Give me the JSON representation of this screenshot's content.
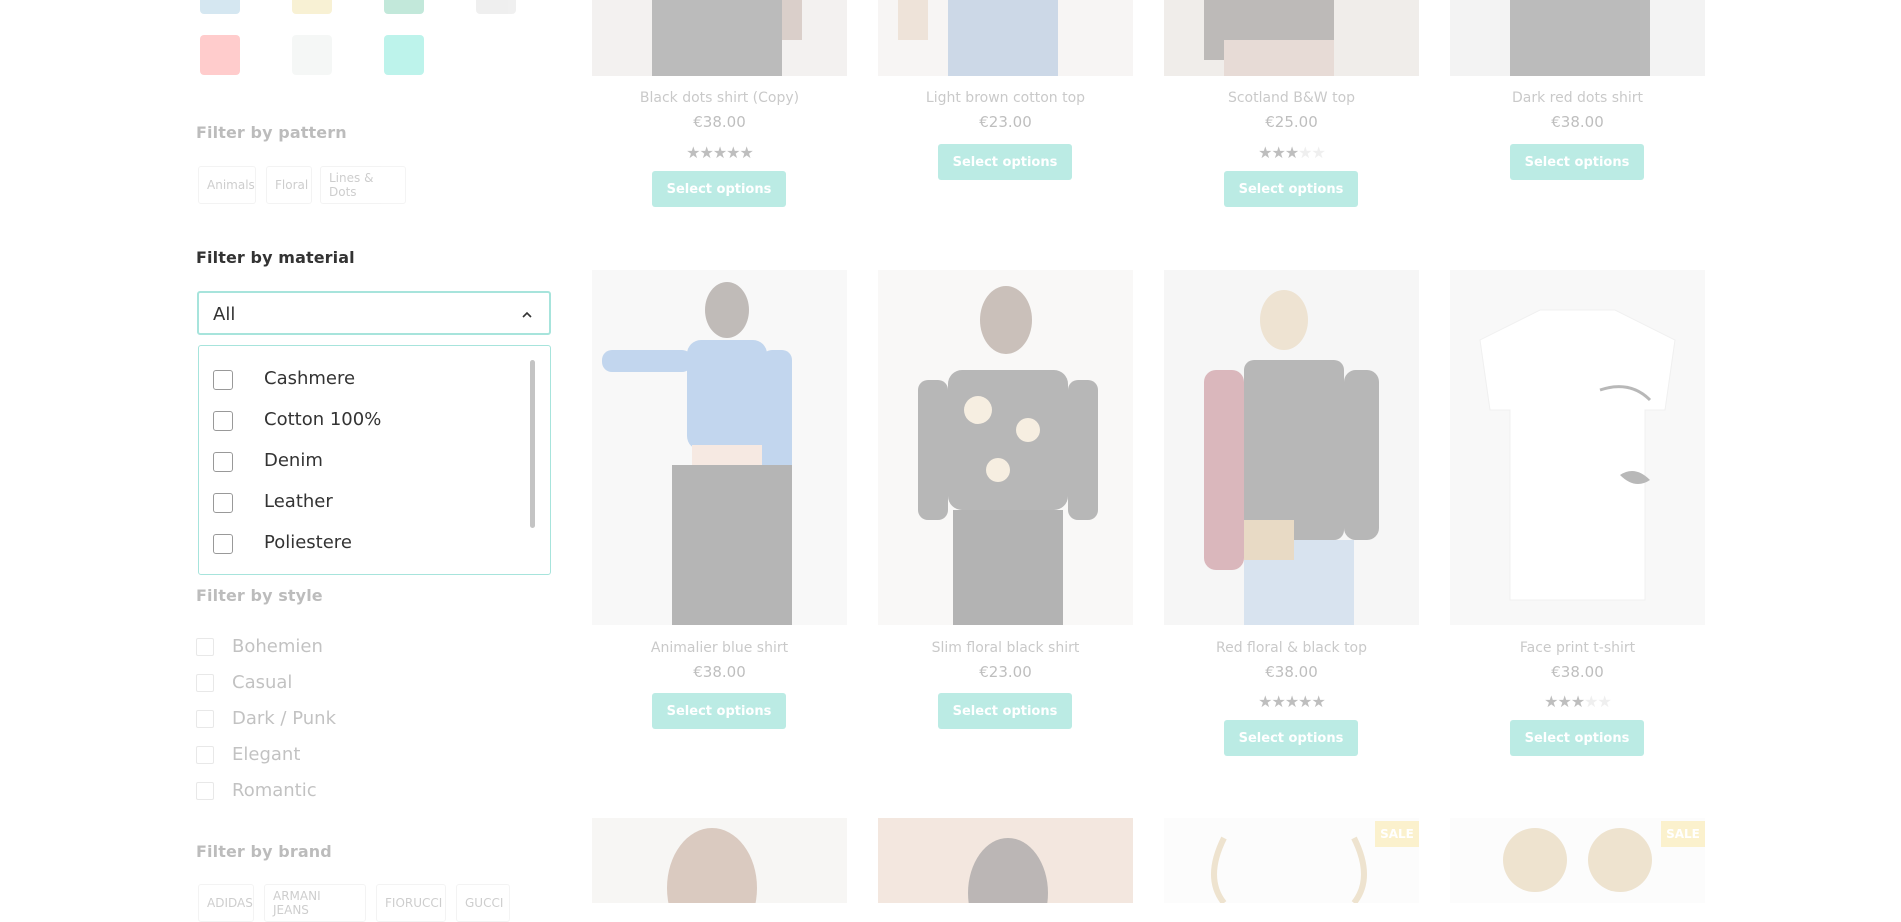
{
  "sidebar": {
    "colors": {
      "top_row": [
        "#7fb6d6",
        "#ecd57b",
        "#43bb8f",
        "#cfcfcf"
      ],
      "second_row": [
        "#ff6464",
        "#e3e8e6",
        "#34dcc4"
      ]
    },
    "pattern": {
      "title": "Filter by pattern",
      "chips": [
        "Animals",
        "Floral",
        "Lines & Dots"
      ]
    },
    "material": {
      "title": "Filter by material",
      "selected": "All",
      "options": [
        "Cashmere",
        "Cotton 100%",
        "Denim",
        "Leather",
        "Poliestere"
      ]
    },
    "style": {
      "title": "Filter by style",
      "options": [
        "Bohemien",
        "Casual",
        "Dark / Punk",
        "Elegant",
        "Romantic"
      ]
    },
    "brand": {
      "title": "Filter by brand",
      "chips": [
        "ADIDAS",
        "ARMANI JEANS",
        "FIORUCCI",
        "GUCCI"
      ]
    }
  },
  "products": {
    "row1": [
      {
        "name": "Black dots shirt (Copy)",
        "price": "€38.00",
        "rating": 5,
        "button": "Select options"
      },
      {
        "name": "Light brown cotton top",
        "price": "€23.00",
        "rating": 0,
        "button": "Select options"
      },
      {
        "name": "Scotland B&W top",
        "price": "€25.00",
        "rating": 3,
        "button": "Select options"
      },
      {
        "name": "Dark red dots shirt",
        "price": "€38.00",
        "rating": 0,
        "button": "Select options"
      }
    ],
    "row2": [
      {
        "name": "Animalier blue shirt",
        "price": "€38.00",
        "rating": 0,
        "button": "Select options"
      },
      {
        "name": "Slim floral black shirt",
        "price": "€23.00",
        "rating": 0,
        "button": "Select options"
      },
      {
        "name": "Red floral & black top",
        "price": "€38.00",
        "rating": 5,
        "button": "Select options"
      },
      {
        "name": "Face print t-shirt",
        "price": "€38.00",
        "rating": 3,
        "button": "Select options"
      }
    ],
    "row3_sale_badge": "SALE",
    "star_glyph": "★",
    "accent_color": "#29c1ab"
  }
}
